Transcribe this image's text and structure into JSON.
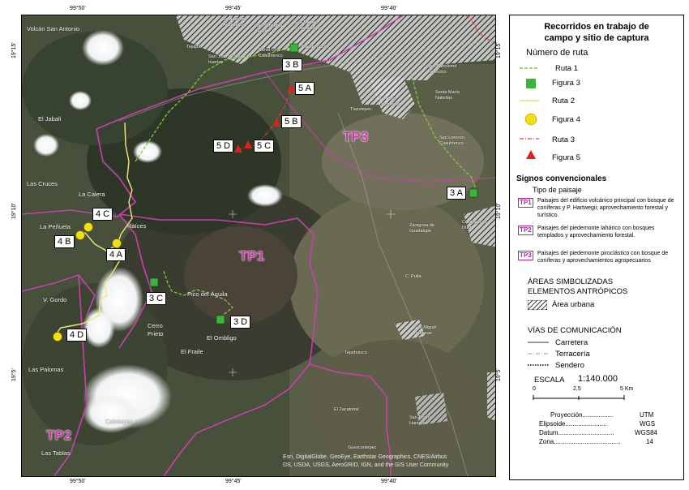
{
  "map": {
    "coords": {
      "top": [
        "99°50'",
        "99°45'",
        "99°40'"
      ],
      "bottom": [
        "99°50'",
        "99°45'",
        "99°40'"
      ],
      "left": [
        "19°15'",
        "19°10'",
        "19°5'"
      ],
      "right": [
        "19°15'",
        "19°10'",
        "19°5'"
      ]
    },
    "places": [
      "Volcán San Antonio",
      "El Jabalí",
      "Las Cruces",
      "La Calera",
      "Raíces",
      "La Peñuela",
      "V. Gordo",
      "Cerro Prieto",
      "El Fraile",
      "Las Palomas",
      "Calotepec",
      "Las Tablas",
      "Pico del Águila",
      "El Ombligo",
      "Tepehuixco",
      "El Zacatonal",
      "Guescontepec",
      "San Pedro Hanixco",
      "C. Putla",
      "San Miguel Balderas",
      "Zaragoza de Guadalupe",
      "Calimaya de Díaz",
      "San Lorenzo Cuauhtenco",
      "Santa María Nativitas",
      "San Bartolomé Tlatelulco",
      "Santiago Tlacotepec",
      "Tlacotepec",
      "Cacalomacán",
      "San Miguel Zinacantepec",
      "San Cristóbal Tecolit",
      "Sn Antonio Acahualco",
      "Santa Cruz Cuauhtenco",
      "San Juan de las huertas",
      "Tejalpa"
    ],
    "zones": [
      "TP1",
      "TP2",
      "TP3"
    ],
    "markers": [
      "3 A",
      "3 B",
      "3 C",
      "3 D",
      "4 A",
      "4 B",
      "4 C",
      "4 D",
      "5 A",
      "5 B",
      "5 C",
      "5 D"
    ],
    "attribution": [
      "Esri, DigitalGlobe, GeoEye, Earthstar Geographics, CNES/Airbus",
      "DS, USDA, USGS, AeroGRID, IGN, and the GIS User Community"
    ]
  },
  "legend": {
    "title_line1": "Recorridos en trabajo de",
    "title_line2": "campo y sitio de captura",
    "routes_heading": "Número de ruta",
    "ruta1": "Ruta 1",
    "fig3": "Figura 3",
    "ruta2": "Ruta 2",
    "fig4": "Figura 4",
    "ruta3": "Ruta 3",
    "fig5": "Figura 5",
    "signs_heading": "Signos convencionales",
    "landscape_heading": "Tipo de paisaje",
    "tp1_code": "TP1",
    "tp1_desc": "Paisajes del edificio volcánico principal con bosque de coníferas y P. Hartwegii; aprovechamiento forestal y turístico.",
    "tp2_code": "TP2",
    "tp2_desc": "Paisajes del piedemonte lahárico con bosques templados y aprovechamiento forestal.",
    "tp3_code": "TP3",
    "tp3_desc": "Paisajes del piedemonte piroclástico con bosque de coníferas y aprovechamientos agropecuarios",
    "areas_heading_1": "ÁREAS SIMBOLIZADAS",
    "areas_heading_2": "ELEMENTOS ANTRÓPICOS",
    "urban": "Área urbana",
    "roads_heading": "VÍAS DE COMUNICACIÓN",
    "road1": "Carretera",
    "road2": "Terracería",
    "road3": "Sendero",
    "scale_label": "ESCALA",
    "scale_value": "1:140.000",
    "scale_ticks": [
      "0",
      "2,5",
      "5 Km"
    ],
    "proj": [
      {
        "k": "Proyección.................",
        "v": "UTM"
      },
      {
        "k": "Elipsoide.......................",
        "v": "WGS"
      },
      {
        "k": "Datum...............................",
        "v": "WGS84"
      },
      {
        "k": "Zona.....................................",
        "v": "14"
      }
    ],
    "colors": {
      "ruta1": "#7ccd3c",
      "ruta2": "#f0ec78",
      "ruta3": "#e04030",
      "fig3": "#3cb43c",
      "fig4": "#f0e010",
      "fig5": "#e02020",
      "tp": "#b0289a"
    }
  }
}
